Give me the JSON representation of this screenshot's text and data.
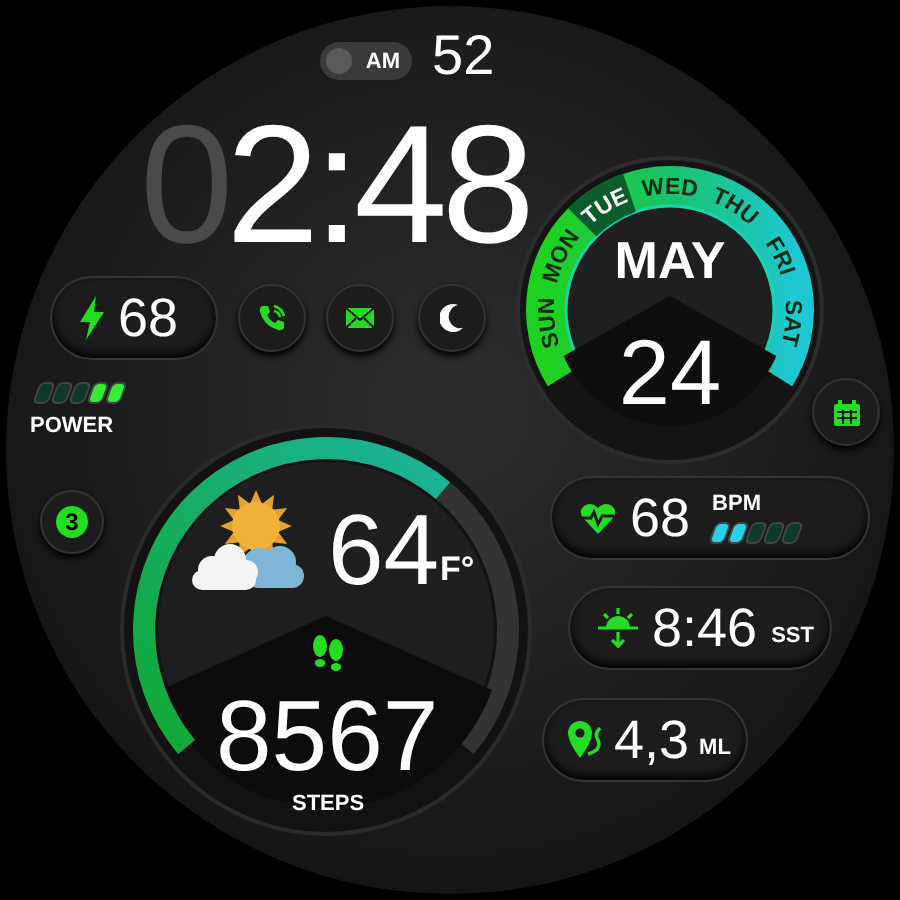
{
  "status": {
    "meridiem": "AM",
    "seconds": "52"
  },
  "time": {
    "leading_digit": "0",
    "value": "2:48"
  },
  "battery": {
    "value": "68",
    "level": 0.4,
    "label": "POWER"
  },
  "shortcuts": [
    {
      "kind": "phone"
    },
    {
      "kind": "mail"
    },
    {
      "kind": "moon"
    }
  ],
  "calendar": {
    "days": [
      {
        "label": "SUN",
        "selected": false
      },
      {
        "label": "MON",
        "selected": false
      },
      {
        "label": "TUE",
        "selected": true
      },
      {
        "label": "WED",
        "selected": false
      },
      {
        "label": "THU",
        "selected": false
      },
      {
        "label": "FRI",
        "selected": false
      },
      {
        "label": "SAT",
        "selected": false
      }
    ],
    "month": "MAY",
    "day": "24"
  },
  "notifications": {
    "count": "3"
  },
  "weather": {
    "temperature": "64",
    "unit": "F°"
  },
  "steps": {
    "value": "8567",
    "label": "STEPS"
  },
  "stats": [
    {
      "kind": "heart",
      "value": "68",
      "unit": "BPM",
      "level": 0.4
    },
    {
      "kind": "sunset",
      "value": "8:46",
      "unit": "SST"
    },
    {
      "kind": "distance",
      "value": "4,3",
      "unit": "ML"
    }
  ]
}
